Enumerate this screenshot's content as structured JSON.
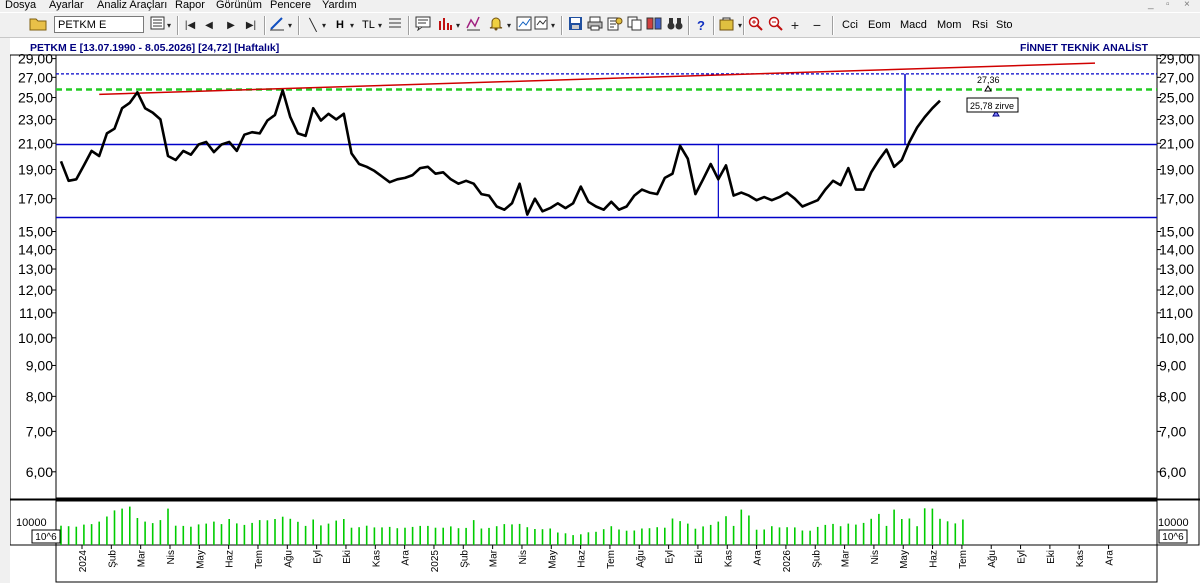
{
  "menu": [
    "Dosya",
    "Ayarlar",
    "Analiz Araçları",
    "Rapor",
    "Görünüm",
    "Pencere",
    "Yardım"
  ],
  "window_controls": [
    "_",
    "▫",
    "×"
  ],
  "toolbar": {
    "symbol": "PETKM E",
    "line_label": "H",
    "tl_label": "TL",
    "indicators": [
      "Cci",
      "Eom",
      "Macd",
      "Mom",
      "Rsi",
      "Sto"
    ],
    "icons": [
      "open-folder-icon",
      "chart-type-icon",
      "first-icon",
      "prev-icon",
      "next-icon",
      "last-icon",
      "drawing-icon",
      "line-tool-icon",
      "horizontal-line-icon",
      "trendline-icon",
      "text-tool-icon",
      "comment-icon",
      "bar-chart-icon",
      "scale-icon",
      "alarm-bell-icon",
      "indicator-icon",
      "chart-style-icon",
      "save-icon",
      "print-icon",
      "properties-icon",
      "copy-icon",
      "compare-icon",
      "binoculars-icon",
      "help-icon",
      "color-icon",
      "zoom-in-icon",
      "zoom-out-icon",
      "plus-icon",
      "minus-icon"
    ]
  },
  "chart": {
    "header_left": "PETKM E  [13.07.1990 - 8.05.2026]  [24,72]  [Haftalık]",
    "header_right": "FİNNET TEKNİK ANALİST",
    "level_label_top": "27,36",
    "level_label_zirve": "25,78 zirve",
    "volume_tick": "10000",
    "volume_unit": "10^6",
    "colors": {
      "price": "#000000",
      "channel": "#0000c8",
      "resistance": "#d00000",
      "dashed_blue": "#0000c8",
      "dashed_green": "#22cc22",
      "volume": "#00cc00",
      "text_blue": "#000080"
    }
  },
  "chart_data": {
    "type": "line",
    "scale": "log",
    "y_ticks": [
      "29,00",
      "27,00",
      "25,00",
      "23,00",
      "21,00",
      "19,00",
      "17,00",
      "15,00",
      "14,00",
      "13,00",
      "12,00",
      "11,00",
      "10,00",
      "9,00",
      "8,00",
      "7,00",
      "6,00"
    ],
    "y_tick_values": [
      29,
      27,
      25,
      23,
      21,
      19,
      17,
      15,
      14,
      13,
      12,
      11,
      10,
      9,
      8,
      7,
      6
    ],
    "x_labels": [
      "2024",
      "Şub",
      "Mar",
      "Nis",
      "May",
      "Haz",
      "Tem",
      "Ağu",
      "Eyl",
      "Eki",
      "Kas",
      "Ara",
      "2025",
      "Şub",
      "Mar",
      "Nis",
      "May",
      "Haz",
      "Tem",
      "Ağu",
      "Eyl",
      "Eki",
      "Kas",
      "Ara",
      "2026",
      "Şub",
      "Mar",
      "Nis",
      "May",
      "Haz",
      "Tem",
      "Ağu",
      "Eyl",
      "Eki",
      "Kas",
      "Ara"
    ],
    "price": [
      19.6,
      18.2,
      18.3,
      19.3,
      20.4,
      20.0,
      21.8,
      22.2,
      24.0,
      24.5,
      25.5,
      24.0,
      23.6,
      23.0,
      20.0,
      19.7,
      20.4,
      20.1,
      20.9,
      21.1,
      20.3,
      20.9,
      21.1,
      20.4,
      21.7,
      21.9,
      21.8,
      22.9,
      23.4,
      25.7,
      23.2,
      21.8,
      21.6,
      24.0,
      22.9,
      23.5,
      23.0,
      23.5,
      20.2,
      19.4,
      19.2,
      18.9,
      18.5,
      18.1,
      18.3,
      18.4,
      18.6,
      19.1,
      19.2,
      18.7,
      18.8,
      18.3,
      18.0,
      18.2,
      18.0,
      17.3,
      17.2,
      16.5,
      16.3,
      16.7,
      18.0,
      16.0,
      17.0,
      16.2,
      16.4,
      16.7,
      16.4,
      16.7,
      17.8,
      16.8,
      16.5,
      16.3,
      16.8,
      16.3,
      16.5,
      17.2,
      17.6,
      17.4,
      17.3,
      18.4,
      18.7,
      20.8,
      19.8,
      17.3,
      18.3,
      19.4,
      18.3,
      19.3,
      17.2,
      17.4,
      17.2,
      16.9,
      17.1,
      16.9,
      17.1,
      17.4,
      17.0,
      16.5,
      16.7,
      16.9,
      17.6,
      18.2,
      17.9,
      19.1,
      17.6,
      17.6,
      18.8,
      19.7,
      20.5,
      19.2,
      19.7,
      21.1,
      22.3,
      23.2,
      24.0,
      24.7
    ],
    "channel_upper": 20.9,
    "channel_lower": 15.82,
    "dashed_blue_level": 27.36,
    "dashed_green_level": 25.78,
    "resistance_line": {
      "from": 25.3,
      "to": 28.5
    },
    "volume": [
      7600,
      7400,
      7200,
      8000,
      8200,
      9200,
      11200,
      13600,
      14300,
      15100,
      10600,
      9200,
      8600,
      9800,
      14300,
      7600,
      7500,
      7200,
      8100,
      8400,
      9200,
      8200,
      10200,
      8500,
      7900,
      8700,
      9800,
      9700,
      10200,
      11100,
      10300,
      9100,
      7500,
      10000,
      7700,
      8400,
      9600,
      10200,
      6800,
      7000,
      7600,
      6900,
      6900,
      7100,
      6600,
      6800,
      7100,
      7500,
      7500,
      6800,
      6800,
      7300,
      6600,
      6700,
      9800,
      6500,
      6700,
      7400,
      8200,
      8100,
      8300,
      7000,
      6300,
      6200,
      6500,
      4900,
      4600,
      3900,
      4200,
      5000,
      5200,
      6200,
      7400,
      6100,
      5600,
      5700,
      6500,
      6600,
      7000,
      6800,
      10400,
      9400,
      8400,
      6400,
      7300,
      7900,
      9200,
      11300,
      7500,
      13900,
      11600,
      6000,
      6100,
      7400,
      6900,
      7000,
      6900,
      5700,
      5600,
      7100,
      7900,
      8300,
      7400,
      8400,
      8000,
      8700,
      10300,
      12200,
      7500,
      13900,
      10200,
      10400,
      7400,
      14400,
      14300,
      10300,
      9300,
      8500,
      10000
    ]
  }
}
